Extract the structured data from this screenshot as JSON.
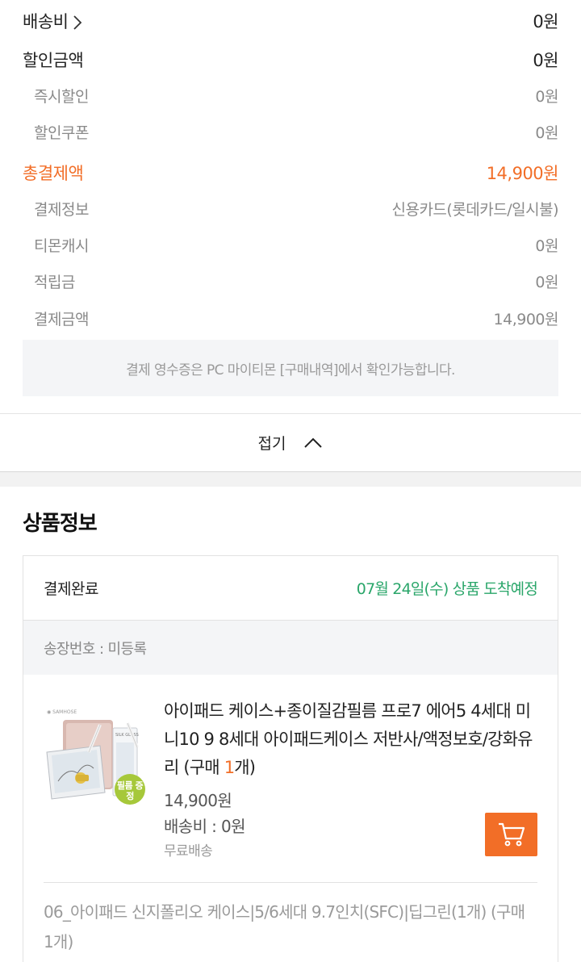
{
  "summary": {
    "shipping": {
      "label": "배송비",
      "value": "0원"
    },
    "discount": {
      "label": "할인금액",
      "value": "0원"
    },
    "instant_discount": {
      "label": "즉시할인",
      "value": "0원"
    },
    "coupon_discount": {
      "label": "할인쿠폰",
      "value": "0원"
    },
    "total": {
      "label": "총결제액",
      "value": "14,900원"
    },
    "payment_info": {
      "label": "결제정보",
      "value": "신용카드(롯데카드/일시불)"
    },
    "tmon_cash": {
      "label": "티몬캐시",
      "value": "0원"
    },
    "points": {
      "label": "적립금",
      "value": "0원"
    },
    "paid_amount": {
      "label": "결제금액",
      "value": "14,900원"
    },
    "receipt_notice": "결제 영수증은 PC 마이티몬 [구매내역]에서 확인가능합니다.",
    "fold_label": "접기"
  },
  "product_section": {
    "title": "상품정보",
    "status": "결제완료",
    "delivery": "07월 24일(수) 상품 도착예정",
    "invoice": "송장번호 : 미등록",
    "item": {
      "name_prefix": "아이패드 케이스+종이질감필름 프로7 에어5 4세대 미니10 9 8세대 아이패드케이스 저반사/액정보호/강화유리 (구매 ",
      "qty": "1",
      "name_suffix": "개)",
      "price": "14,900원",
      "shipping": "배송비 : 0원",
      "free_shipping": "무료배송",
      "badge": "필름 증정"
    },
    "option": "06_아이패드 신지폴리오 케이스|5/6세대 9.7인치(SFC)|딥그린(1개) (구매 1개)"
  },
  "colors": {
    "accent": "#f26e27",
    "delivery": "#2aa66a"
  },
  "icons": {
    "shipping_chevron": "chevron-right-icon",
    "fold": "chevron-up-icon",
    "cart": "cart-icon"
  }
}
